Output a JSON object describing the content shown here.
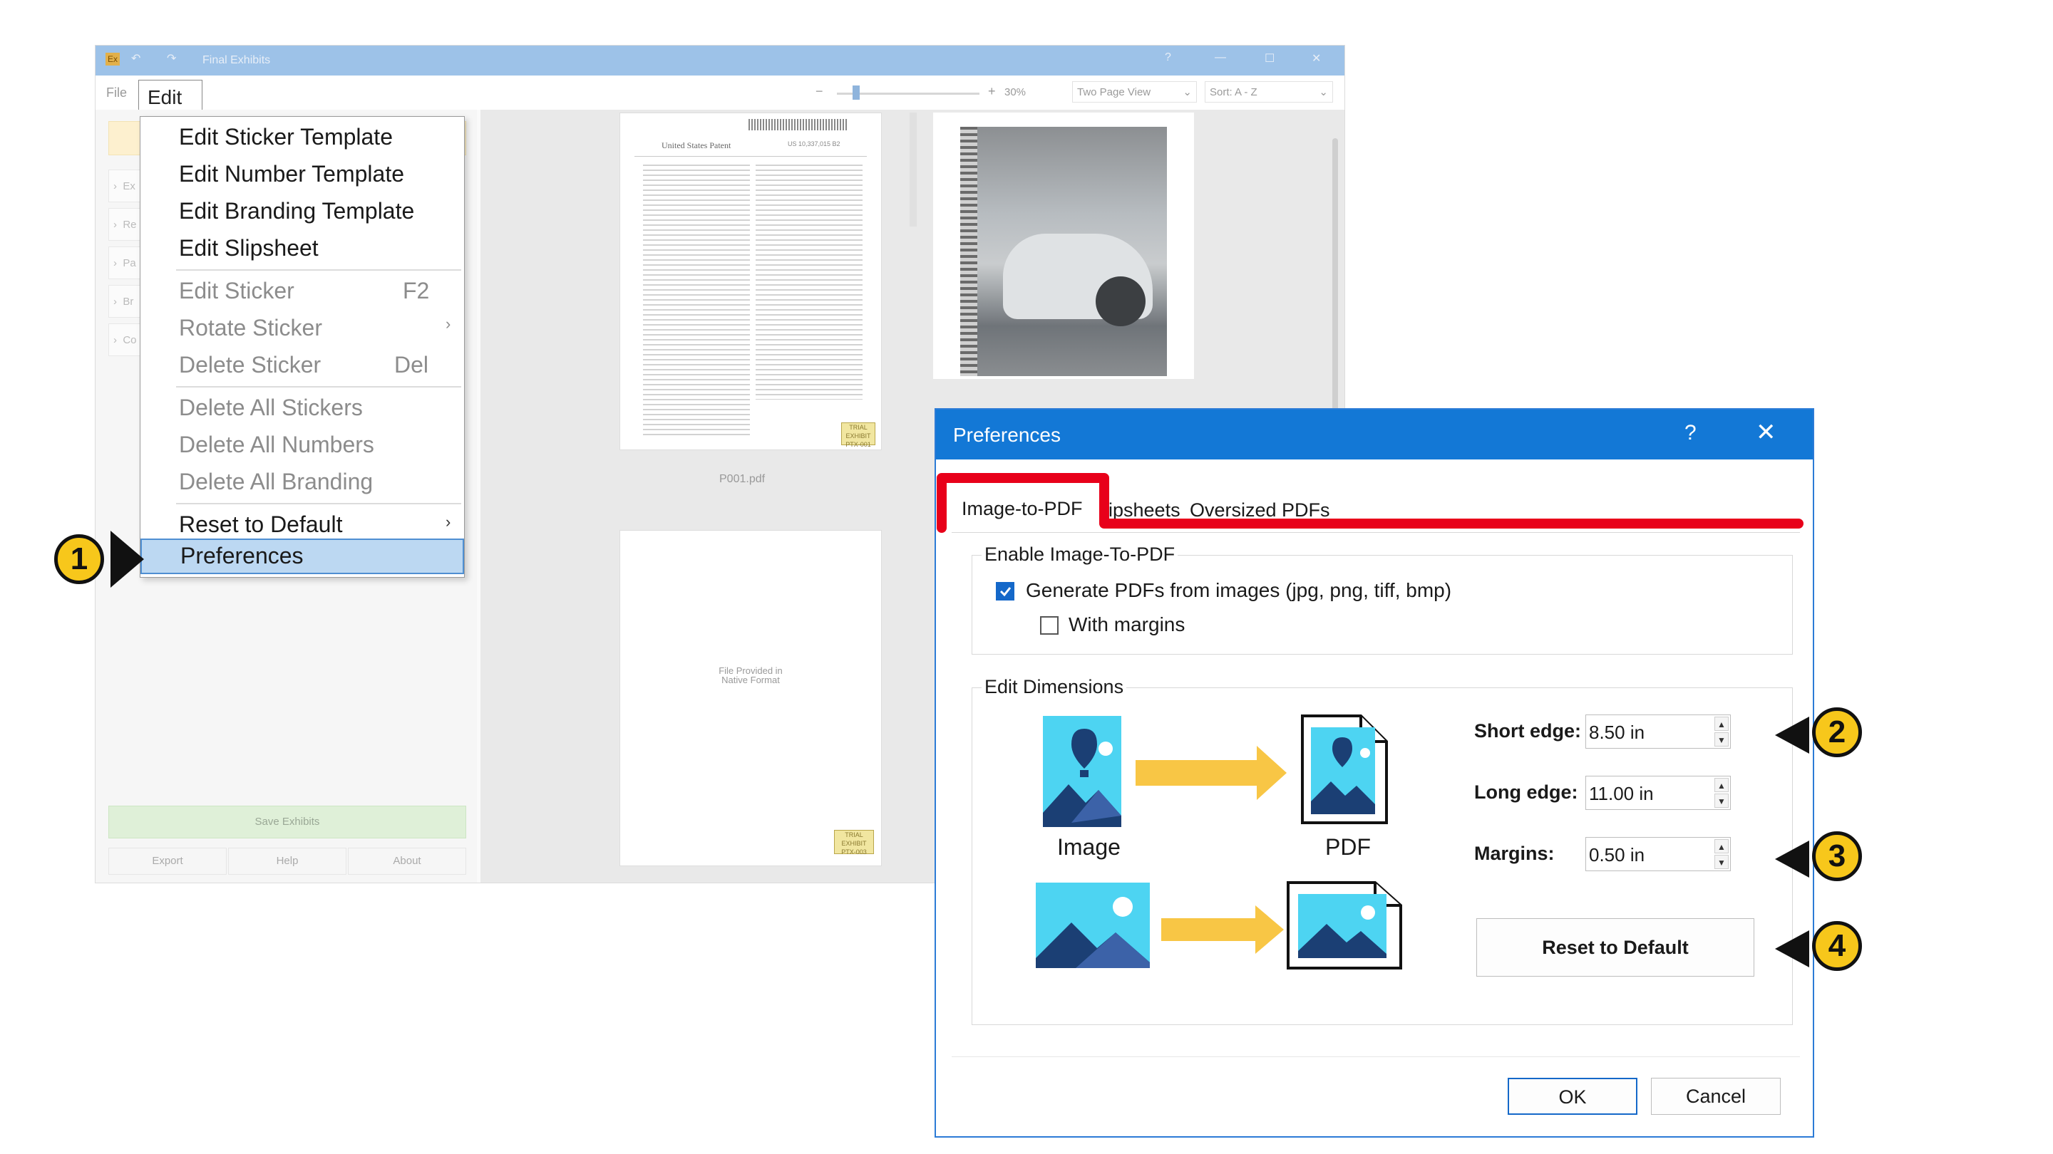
{
  "app": {
    "title": "Final Exhibits",
    "logo": "Ex",
    "menu": {
      "file": "File",
      "edit": "Edit"
    },
    "zoom": "30%",
    "view_mode": "Two Page View",
    "sort": "Sort: A - Z",
    "sidebar_items": [
      "Ex",
      "Re",
      "Pa",
      "Br",
      "Co"
    ],
    "save_button": "Save Exhibits",
    "bottom_buttons": {
      "export": "Export",
      "help": "Help",
      "about": "About"
    },
    "documents": {
      "first_filename": "P001.pdf",
      "patent_title": "United States Patent",
      "patent_number": "US 10,337,015 B2",
      "native_text": "File Provided in Native Format",
      "sticker1": "PTX-001",
      "sticker2": "PTX-003",
      "sticker_label": "TRIAL EXHIBIT"
    }
  },
  "edit_menu": {
    "items": [
      {
        "label": "Edit Sticker Template",
        "shortcut": "",
        "enabled": true
      },
      {
        "label": "Edit Number Template",
        "shortcut": "",
        "enabled": true
      },
      {
        "label": "Edit Branding Template",
        "shortcut": "",
        "enabled": true
      },
      {
        "label": "Edit Slipsheet",
        "shortcut": "",
        "enabled": true
      },
      {
        "label": "Edit Sticker",
        "shortcut": "F2",
        "enabled": false
      },
      {
        "label": "Rotate Sticker",
        "shortcut": "›",
        "enabled": false
      },
      {
        "label": "Delete Sticker",
        "shortcut": "Del",
        "enabled": false
      },
      {
        "label": "Delete All Stickers",
        "shortcut": "",
        "enabled": false
      },
      {
        "label": "Delete All Numbers",
        "shortcut": "",
        "enabled": false
      },
      {
        "label": "Delete All Branding",
        "shortcut": "",
        "enabled": false
      },
      {
        "label": "Reset to Default",
        "shortcut": "›",
        "enabled": true
      },
      {
        "label": "Preferences",
        "shortcut": "",
        "enabled": true
      }
    ]
  },
  "callouts": [
    "1",
    "2",
    "3",
    "4"
  ],
  "dialog": {
    "title": "Preferences",
    "help": "?",
    "close": "✕",
    "tabs": [
      "Image-to-PDF",
      "Slipsheets",
      "Oversized PDFs"
    ],
    "tabs_visible": [
      "Image-to-PDF",
      "ipsheets",
      "Oversized PDFs"
    ],
    "active_tab": "Image-to-PDF",
    "enable_group": "Enable Image-To-PDF",
    "generate_label": "Generate PDFs from images (jpg, png, tiff, bmp)",
    "generate_checked": true,
    "margins_label": "With margins",
    "margins_checked": false,
    "dimensions_group": "Edit Dimensions",
    "image_caption": "Image",
    "pdf_caption": "PDF",
    "short_edge_label": "Short edge:",
    "short_edge_value": "8.50 in",
    "long_edge_label": "Long edge:",
    "long_edge_value": "11.00 in",
    "margins_field_label": "Margins:",
    "margins_value": "0.50 in",
    "reset_button": "Reset to Default",
    "ok_button": "OK",
    "cancel_button": "Cancel"
  },
  "colors": {
    "dialog_title": "#1378d6",
    "highlight": "#e8001a",
    "callout": "#f7c71b",
    "image_tile": "#4dd4f2",
    "arrow": "#f8c645"
  }
}
